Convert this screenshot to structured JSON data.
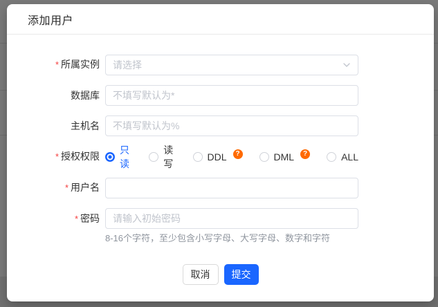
{
  "colors": {
    "accent_blue": "#1a66ff",
    "help_badge_orange": "#ff6a00",
    "required_red": "#f53f3f",
    "overlay_grey": "#7a7a7a"
  },
  "required_mark": "*",
  "help_badge_glyph": "?",
  "dialog": {
    "title": "添加用户",
    "form": {
      "instance": {
        "label": "所属实例",
        "placeholder": "请选择"
      },
      "database": {
        "label": "数据库",
        "placeholder": "不填写默认为*"
      },
      "hostname": {
        "label": "主机名",
        "placeholder": "不填写默认为%"
      },
      "permission": {
        "label": "授权权限",
        "options": [
          {
            "label": "只读",
            "selected": true
          },
          {
            "label": "读写",
            "selected": false
          },
          {
            "label": "DDL",
            "selected": false,
            "help": true
          },
          {
            "label": "DML",
            "selected": false,
            "help": true
          },
          {
            "label": "ALL",
            "selected": false
          }
        ]
      },
      "username": {
        "label": "用户名",
        "value": "",
        "placeholder": ""
      },
      "password": {
        "label": "密码",
        "placeholder": "请输入初始密码",
        "helper": "8-16个字符，至少包含小写字母、大写字母、数字和字符"
      }
    },
    "footer": {
      "cancel_label": "取消",
      "submit_label": "提交"
    }
  }
}
